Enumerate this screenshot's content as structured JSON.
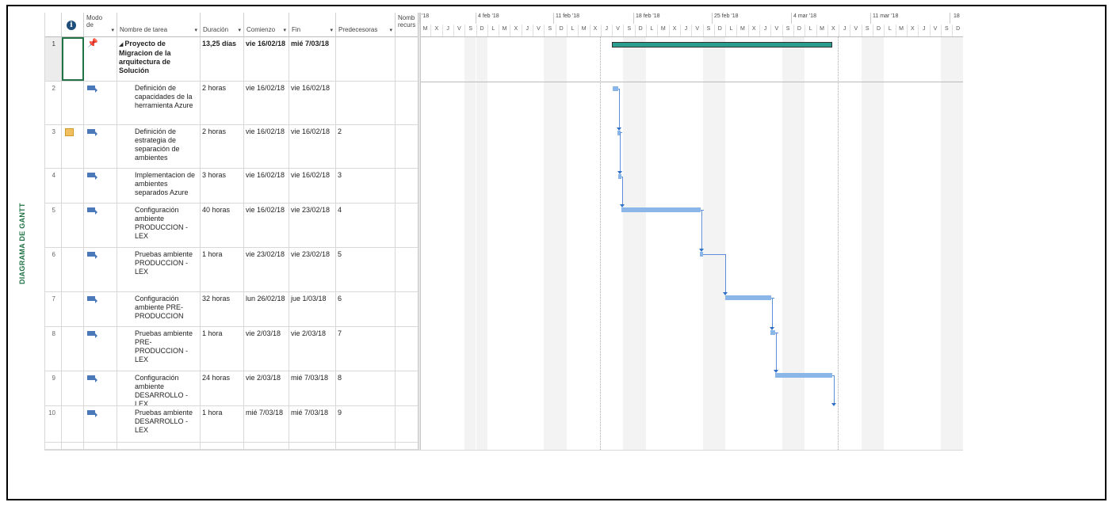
{
  "view": {
    "label": "DIAGRAMA DE GANTT"
  },
  "columns": {
    "info": "i",
    "mode": "Modo de",
    "name": "Nombre de tarea",
    "duration": "Duración",
    "start": "Comienzo",
    "finish": "Fin",
    "predecessors": "Predecesoras",
    "resources": "Nomb recurs"
  },
  "tasks": [
    {
      "id": "1",
      "name": "Proyecto de Migracion de la arquitectura de Solución",
      "duration": "13,25 días",
      "start": "vie 16/02/18",
      "finish": "mié 7/03/18",
      "predecessors": "",
      "summary": true
    },
    {
      "id": "2",
      "name": "Definición de capacidades de la herramienta Azure",
      "duration": "2 horas",
      "start": "vie 16/02/18",
      "finish": "vie 16/02/18",
      "predecessors": ""
    },
    {
      "id": "3",
      "name": "Definición de estrategia de separación de ambientes",
      "duration": "2 horas",
      "start": "vie 16/02/18",
      "finish": "vie 16/02/18",
      "predecessors": "2",
      "note": true
    },
    {
      "id": "4",
      "name": "Implementacion de ambientes separados Azure",
      "duration": "3 horas",
      "start": "vie 16/02/18",
      "finish": "vie 16/02/18",
      "predecessors": "3"
    },
    {
      "id": "5",
      "name": "Configuración ambiente PRODUCCION - LEX",
      "duration": "40 horas",
      "start": "vie 16/02/18",
      "finish": "vie 23/02/18",
      "predecessors": "4"
    },
    {
      "id": "6",
      "name": "Pruebas ambiente PRODUCCION - LEX",
      "duration": "1 hora",
      "start": "vie 23/02/18",
      "finish": "vie 23/02/18",
      "predecessors": "5"
    },
    {
      "id": "7",
      "name": "Configuración ambiente PRE-PRODUCCION",
      "duration": "32 horas",
      "start": "lun 26/02/18",
      "finish": "jue 1/03/18",
      "predecessors": "6"
    },
    {
      "id": "8",
      "name": "Pruebas ambiente PRE-PRODUCCION - LEX",
      "duration": "1 hora",
      "start": "vie 2/03/18",
      "finish": "vie 2/03/18",
      "predecessors": "7"
    },
    {
      "id": "9",
      "name": "Configuración ambiente DESARROLLO - LEX",
      "duration": "24 horas",
      "start": "vie 2/03/18",
      "finish": "mié 7/03/18",
      "predecessors": "8"
    },
    {
      "id": "10",
      "name": "Pruebas ambiente DESARROLLO - LEX",
      "duration": "1 hora",
      "start": "mié 7/03/18",
      "finish": "mié 7/03/18",
      "predecessors": "9"
    }
  ],
  "timescale": {
    "weeks": [
      "'18",
      "4 feb '18",
      "11 feb '18",
      "18 feb '18",
      "25 feb '18",
      "4 mar '18",
      "11 mar '18",
      "18"
    ],
    "days": [
      "M",
      "X",
      "J",
      "V",
      "S",
      "D",
      "L",
      "M",
      "X",
      "J",
      "V",
      "S",
      "D",
      "L",
      "M",
      "X",
      "J",
      "V",
      "S",
      "D",
      "L",
      "M",
      "X",
      "J",
      "V",
      "S",
      "D",
      "L",
      "M",
      "X",
      "J",
      "V",
      "S",
      "D",
      "L",
      "M",
      "X",
      "J",
      "V",
      "S",
      "D",
      "L",
      "M",
      "X",
      "J",
      "V",
      "S",
      "D"
    ]
  },
  "colors": {
    "accent": "#217346",
    "summary_bar": "#2a9d8f",
    "task_bar": "#8ab6e8",
    "link": "#5b8ed6"
  }
}
